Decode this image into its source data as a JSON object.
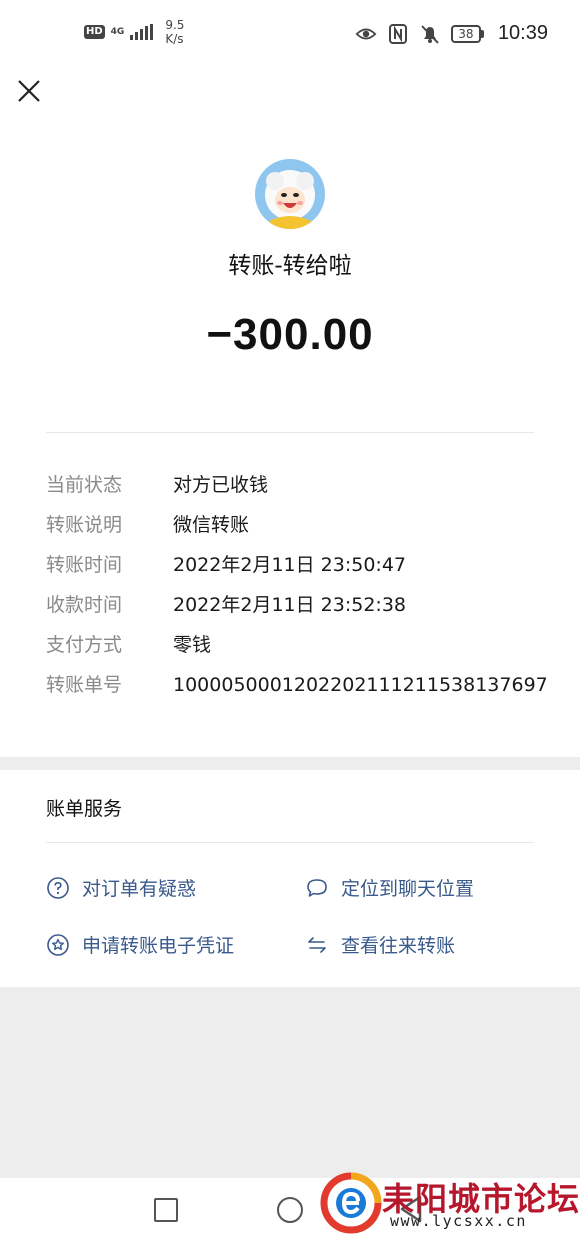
{
  "status_bar": {
    "hd": "HD",
    "network": "4G",
    "speed_value": "9.5",
    "speed_unit": "K/s",
    "battery": "38",
    "time": "10:39"
  },
  "header": {
    "close_icon": "close-icon"
  },
  "transaction": {
    "title": "转账-转给啦",
    "amount": "−300.00",
    "details": [
      {
        "label": "当前状态",
        "value": "对方已收钱"
      },
      {
        "label": "转账说明",
        "value": "微信转账"
      },
      {
        "label": "转账时间",
        "value": "2022年2月11日 23:50:47"
      },
      {
        "label": "收款时间",
        "value": "2022年2月11日 23:52:38"
      },
      {
        "label": "支付方式",
        "value": "零钱"
      },
      {
        "label": "转账单号",
        "value": "10000500012022021112115381376​97"
      }
    ]
  },
  "services": {
    "title": "账单服务",
    "items": [
      {
        "label": "对订单有疑惑",
        "icon": "question-circle-icon"
      },
      {
        "label": "定位到聊天位置",
        "icon": "chat-bubble-icon"
      },
      {
        "label": "申请转账电子凭证",
        "icon": "star-badge-icon"
      },
      {
        "label": "查看往来转账",
        "icon": "exchange-arrows-icon"
      }
    ]
  },
  "watermark": {
    "text": "耒阳城市论坛",
    "url": "www.lycsxx.cn"
  },
  "colors": {
    "link": "#3a5a8c",
    "label": "#8a8a8a",
    "background": "#ededed",
    "watermark": "#b7172c"
  }
}
